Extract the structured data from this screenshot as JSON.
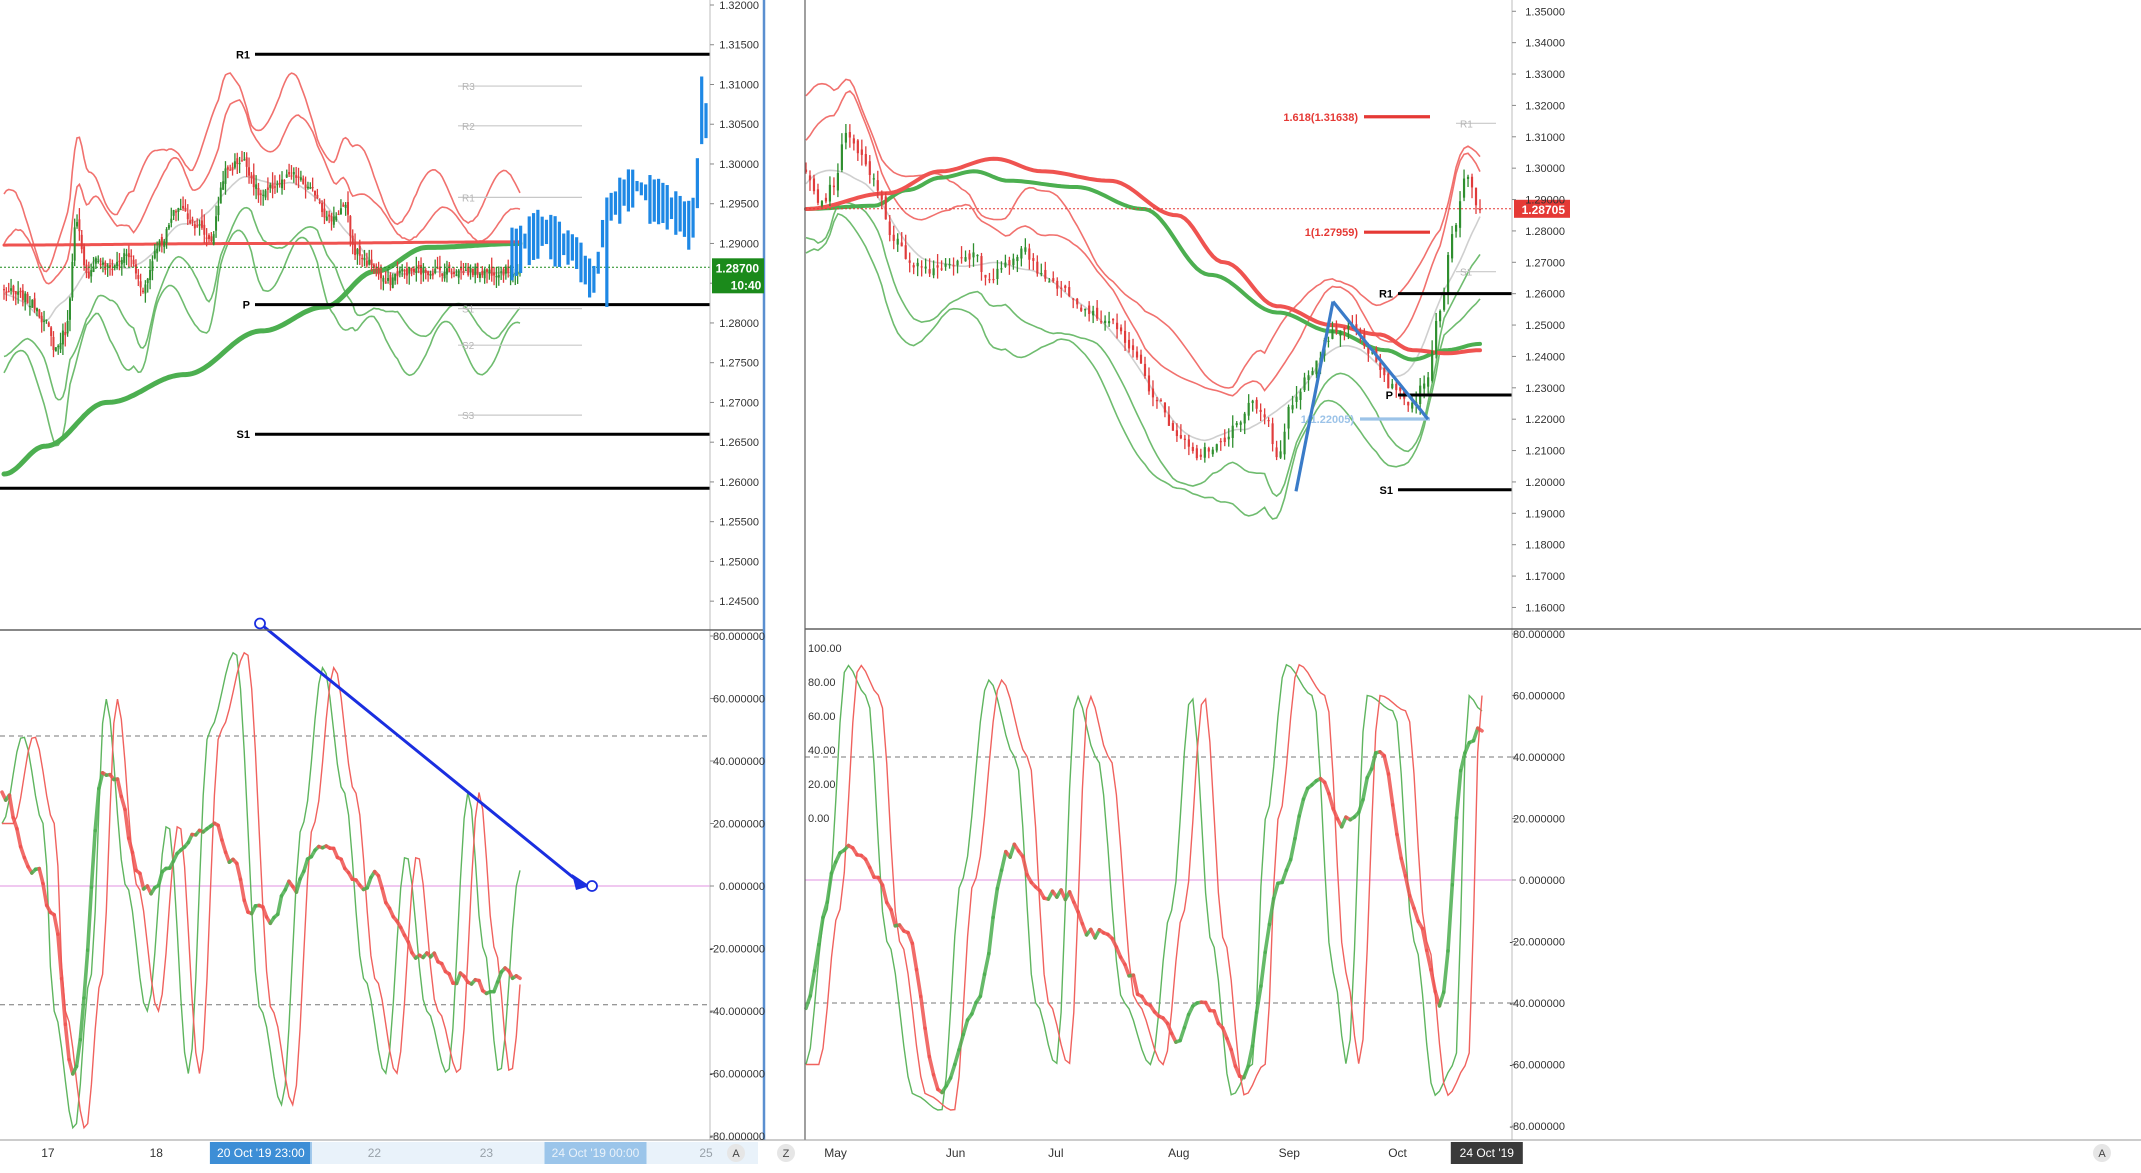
{
  "colors": {
    "bull_candle": "#2f8f2f",
    "bear_candle": "#e03c3c",
    "band_red": "#f0625e",
    "band_green": "#5fb55f",
    "ma_thick_green": "#4caf50",
    "ma_thick_red": "#ef5350",
    "pivot_line": "#000000",
    "forecast_blue": "#1e88e5",
    "arrow_blue": "#1a2ee0",
    "price_label_green": "#1b8a1b",
    "price_label_red": "#e53935",
    "axis_text": "#333333",
    "date_highlight_bg": "#3d8ed6"
  },
  "chart_data": [
    {
      "panel": "left-main",
      "type": "candlestick",
      "y_ticks": [
        "1.32000",
        "1.31500",
        "1.31000",
        "1.30500",
        "1.30000",
        "1.29500",
        "1.29000",
        "1.28500",
        "1.28000",
        "1.27500",
        "1.27000",
        "1.26500",
        "1.26000",
        "1.25500",
        "1.25000",
        "1.24500"
      ],
      "ylim": [
        1.242,
        1.32
      ],
      "x_ticks": [
        "17",
        "18",
        "20 Oct '19  23:00",
        "22",
        "23",
        "24 Oct '19  00:00",
        "25"
      ],
      "current_price_label": "1.28700",
      "countdown_label": "10:40",
      "last_price": 1.287,
      "pivot_levels": [
        {
          "label": "R1",
          "value": 1.3138
        },
        {
          "label": "P",
          "value": 1.2823
        },
        {
          "label": "S1",
          "value": 1.266
        },
        {
          "label": "",
          "value": 1.2592
        }
      ],
      "faint_levels": [
        {
          "label": "R3",
          "value": 1.3098
        },
        {
          "label": "R2",
          "value": 1.3048
        },
        {
          "label": "R1",
          "value": 1.2958
        },
        {
          "label": "S1",
          "value": 1.2818
        },
        {
          "label": "S2",
          "value": 1.2772
        },
        {
          "label": "S3",
          "value": 1.2684
        }
      ]
    },
    {
      "panel": "left-oscillator",
      "type": "line",
      "y_ticks": [
        "80.000000",
        "60.000000",
        "40.000000",
        "20.000000",
        "0.000000",
        "-20.000000",
        "-40.000000",
        "-60.000000",
        "-80.000000"
      ],
      "ylim": [
        -80,
        80
      ],
      "dashed_levels": [
        48,
        -38
      ],
      "arrow": {
        "from": 84,
        "to": 0
      }
    },
    {
      "panel": "right-main",
      "type": "candlestick",
      "y_ticks": [
        "1.35000",
        "1.34000",
        "1.33000",
        "1.32000",
        "1.31000",
        "1.30000",
        "1.29000",
        "1.28000",
        "1.27000",
        "1.26000",
        "1.25000",
        "1.24000",
        "1.23000",
        "1.22000",
        "1.21000",
        "1.20000",
        "1.19000",
        "1.18000",
        "1.17000",
        "1.16000"
      ],
      "ylim": [
        1.156,
        1.352
      ],
      "x_ticks": [
        "May",
        "Jun",
        "Jul",
        "Aug",
        "Sep",
        "Oct",
        "24 Oct '19"
      ],
      "current_price_label": "1.28705",
      "last_price": 1.28705,
      "pivot_levels": [
        {
          "label": "R1",
          "value": 1.26
        },
        {
          "label": "P",
          "value": 1.2277
        },
        {
          "label": "S1",
          "value": 1.1975
        }
      ],
      "faint_levels": [
        {
          "label": "R1",
          "value": 1.3143
        },
        {
          "label": "S1",
          "value": 1.267
        }
      ],
      "fib_levels": [
        {
          "label": "1.618(1.31638)",
          "value": 1.31638
        },
        {
          "label": "1(1.27959)",
          "value": 1.27959
        },
        {
          "label": "1(1.22005)",
          "value": 1.22005
        }
      ]
    },
    {
      "panel": "right-oscillator",
      "type": "line",
      "y_ticks_left": [
        "100.00",
        "80.00",
        "60.00",
        "40.00",
        "20.00",
        "0.00"
      ],
      "y_ticks_right": [
        "80.000000",
        "60.000000",
        "40.000000",
        "20.000000",
        "0.000000",
        "-20.000000",
        "-40.000000",
        "-60.000000",
        "-80.000000"
      ],
      "ylim": [
        -80,
        80
      ],
      "dashed_levels": [
        40,
        -40
      ]
    }
  ],
  "axis_buttons": {
    "z_label": "Z",
    "a_label": "A"
  }
}
